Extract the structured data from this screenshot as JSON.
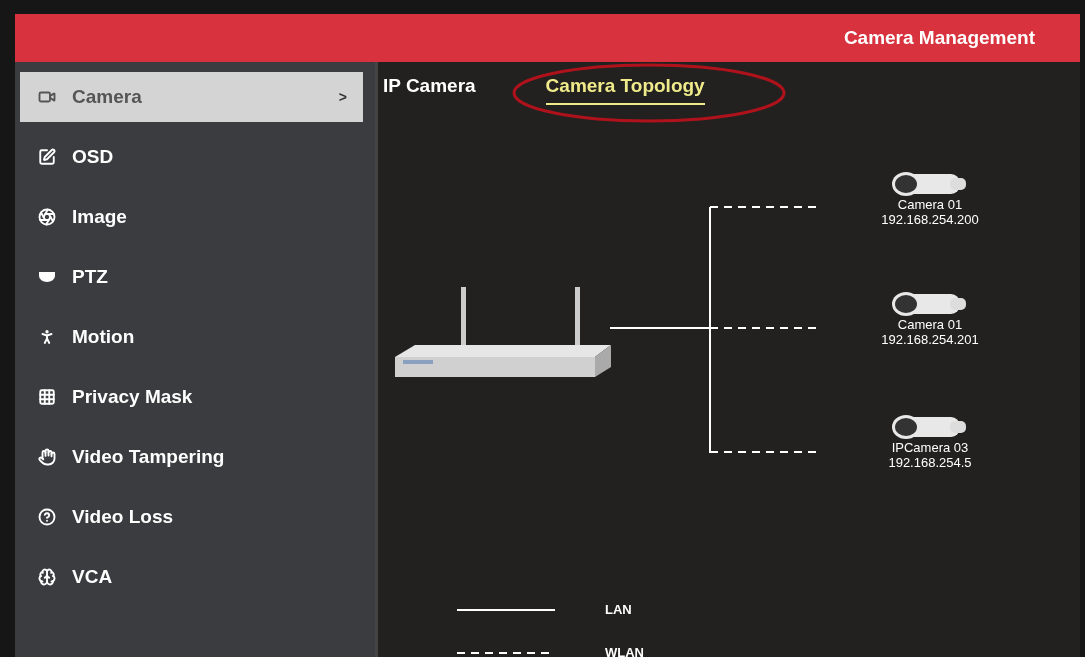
{
  "header": {
    "title": "Camera Management"
  },
  "sidebar": {
    "items": [
      {
        "label": "Camera",
        "selected": true
      },
      {
        "label": "OSD",
        "selected": false
      },
      {
        "label": "Image",
        "selected": false
      },
      {
        "label": "PTZ",
        "selected": false
      },
      {
        "label": "Motion",
        "selected": false
      },
      {
        "label": "Privacy Mask",
        "selected": false
      },
      {
        "label": "Video Tampering",
        "selected": false
      },
      {
        "label": "Video Loss",
        "selected": false
      },
      {
        "label": "VCA",
        "selected": false
      }
    ],
    "chevron": ">"
  },
  "tabs": [
    {
      "label": "IP Camera",
      "selected": false
    },
    {
      "label": "Camera Topology",
      "selected": true
    }
  ],
  "topology": {
    "cameras": [
      {
        "name": "Camera 01",
        "ip": "192.168.254.200"
      },
      {
        "name": "Camera 01",
        "ip": "192.168.254.201"
      },
      {
        "name": "IPCamera 03",
        "ip": "192.168.254.5"
      }
    ]
  },
  "legend": [
    {
      "kind": "solid",
      "label": "LAN"
    },
    {
      "kind": "dashed",
      "label": "WLAN"
    }
  ]
}
